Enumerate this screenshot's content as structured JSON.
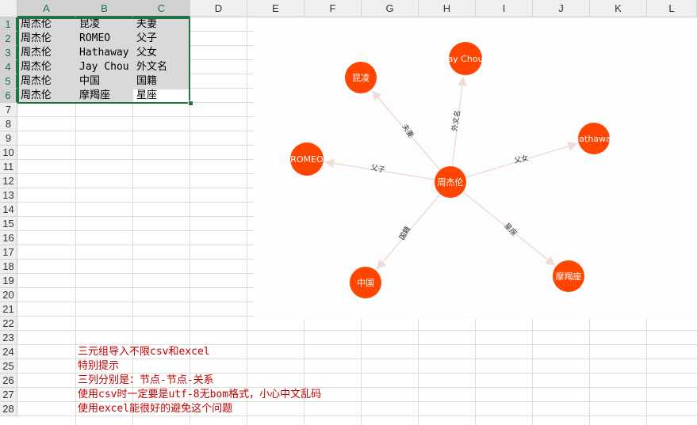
{
  "columns": [
    "A",
    "B",
    "C",
    "D",
    "E",
    "F",
    "G",
    "H",
    "I",
    "J",
    "K",
    "L"
  ],
  "rows": [
    "1",
    "2",
    "3",
    "4",
    "5",
    "6",
    "7",
    "8",
    "9",
    "10",
    "11",
    "12",
    "13",
    "14",
    "15",
    "16",
    "17",
    "18",
    "19",
    "20",
    "21",
    "22",
    "23",
    "24",
    "25",
    "26",
    "27",
    "28"
  ],
  "table": [
    [
      "周杰伦",
      "昆凌",
      "夫妻"
    ],
    [
      "周杰伦",
      "ROMEO",
      "父子"
    ],
    [
      "周杰伦",
      "Hathaway",
      "父女"
    ],
    [
      "周杰伦",
      "Jay Chou",
      "外文名"
    ],
    [
      "周杰伦",
      "中国",
      "国籍"
    ],
    [
      "周杰伦",
      "摩羯座",
      "星座"
    ]
  ],
  "notes": [
    "三元组导入不限csv和excel",
    "特别提示",
    "三列分别是：节点-节点-关系",
    "使用csv时一定要是utf-8无bom格式，小心中文乱码",
    "使用excel能很好的避免这个问题"
  ],
  "graph": {
    "center": "周杰伦",
    "nodes": [
      "昆凌",
      "ay Chou",
      "lathawa",
      "ROMEO",
      "中国",
      "摩羯座"
    ],
    "edge_labels": [
      "夫妻",
      "外文名",
      "父女",
      "父子",
      "国籍",
      "星座"
    ],
    "colors": {
      "node": "#ff4500",
      "edge": "#f0dcd6",
      "text": "#ffffff"
    }
  },
  "colors": {
    "selection_border": "#217346",
    "note_text": "#c00000",
    "header_bg": "#efefef"
  }
}
